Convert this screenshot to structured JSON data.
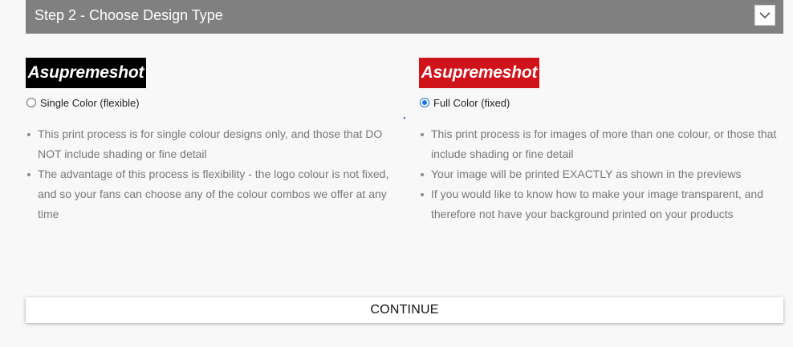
{
  "header": {
    "title": "Step 2 - Choose Design Type",
    "toggle_icon": "chevron-down-icon"
  },
  "options": [
    {
      "logo_text": "Asupremeshot",
      "logo_color": "#000000",
      "label": "Single Color (flexible)",
      "selected": false,
      "points": [
        "This print process is for single colour designs only, and those that DO NOT include shading or fine detail",
        "The advantage of this process is flexibility - the logo colour is not fixed, and so your fans can choose any of the colour combos we offer at any time"
      ]
    },
    {
      "logo_text": "Asupremeshot",
      "logo_color": "#d0121b",
      "label": "Full Color (fixed)",
      "selected": true,
      "points": [
        "This print process is for images of more than one colour, or those that include shading or fine detail",
        "Your image will be printed EXACTLY as shown in the previews",
        "If you would like to know how to make your image transparent, and therefore not have your background printed on your products"
      ]
    }
  ],
  "continue_label": "CONTINUE",
  "colors": {
    "header_bg": "#808080",
    "page_bg": "#f8f8f8",
    "radio_accent": "#1a73e8"
  }
}
